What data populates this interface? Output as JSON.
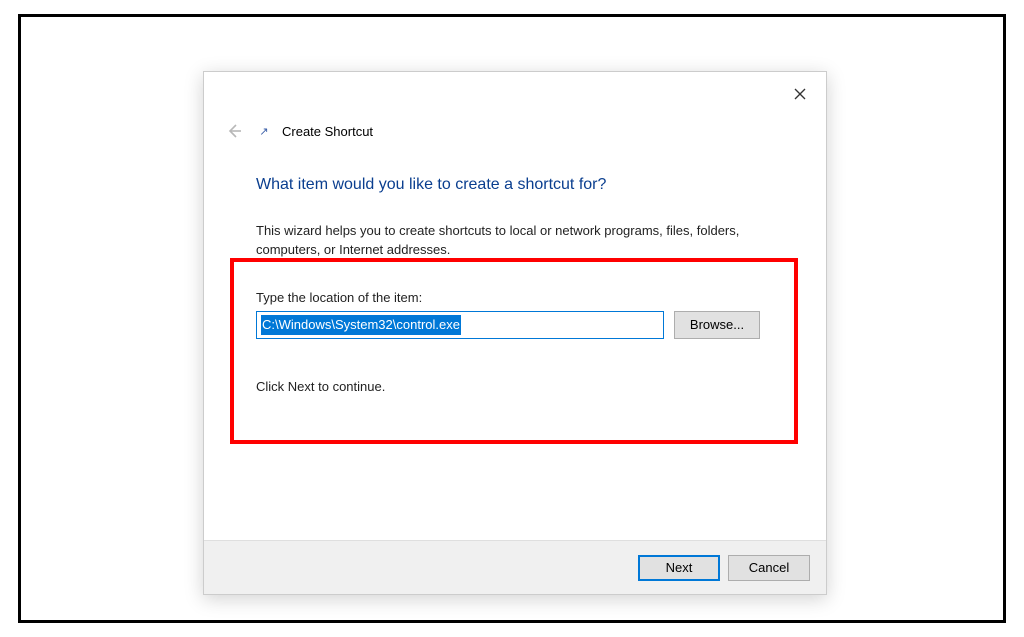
{
  "dialog": {
    "header_title": "Create Shortcut",
    "question": "What item would you like to create a shortcut for?",
    "description": "This wizard helps you to create shortcuts to local or network programs, files, folders, computers, or Internet addresses.",
    "location_label": "Type the location of the item:",
    "path_value": "C:\\Windows\\System32\\control.exe",
    "browse_label": "Browse...",
    "continue_text": "Click Next to continue.",
    "next_label": "Next",
    "cancel_label": "Cancel"
  }
}
